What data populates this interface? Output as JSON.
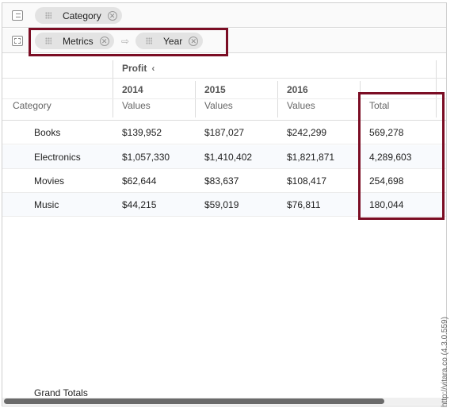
{
  "shelves": {
    "rows": {
      "icon": "row-shelf-icon",
      "pills": [
        "Category"
      ]
    },
    "columns": {
      "icon": "column-shelf-icon",
      "pills": [
        "Metrics",
        "Year"
      ]
    }
  },
  "table": {
    "measure_header": "Profit",
    "collapse_icon": "‹",
    "years": [
      "2014",
      "2015",
      "2016"
    ],
    "value_label": "Values",
    "total_label": "Total",
    "row_header_label": "Category",
    "rows": [
      {
        "category": "Books",
        "v2014": "$139,952",
        "v2015": "$187,027",
        "v2016": "$242,299",
        "total": "569,278"
      },
      {
        "category": "Electronics",
        "v2014": "$1,057,330",
        "v2015": "$1,410,402",
        "v2016": "$1,821,871",
        "total": "4,289,603"
      },
      {
        "category": "Movies",
        "v2014": "$62,644",
        "v2015": "$83,637",
        "v2016": "$108,417",
        "total": "254,698"
      },
      {
        "category": "Music",
        "v2014": "$44,215",
        "v2015": "$59,019",
        "v2016": "$76,811",
        "total": "180,044"
      }
    ],
    "grand_totals_label": "Grand Totals"
  },
  "watermark": "http://vitara.co (4.3.0.559)",
  "colors": {
    "highlight": "#7b0d24",
    "pill": "#e3e3e3"
  }
}
